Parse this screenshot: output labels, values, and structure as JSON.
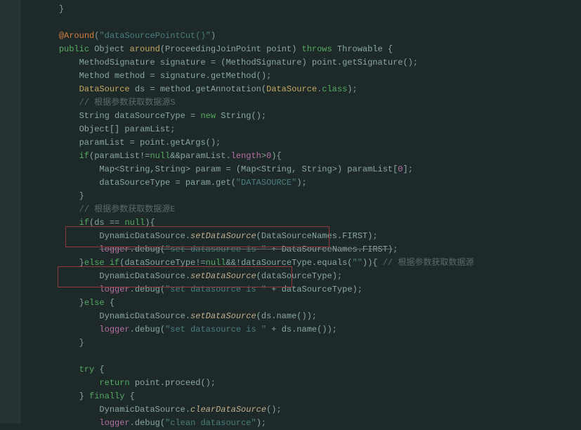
{
  "l1": "}",
  "l2": "@Around",
  "l2b": "(",
  "l2c": "\"dataSourcePointCut()\"",
  "l2d": ")",
  "l3a": "public",
  "l3b": " Object ",
  "l3c": "around",
  "l3d": "(ProceedingJoinPoint point) ",
  "l3e": "throws",
  "l3f": " Throwable {",
  "l4": "MethodSignature signature = (MethodSignature) point.getSignature()",
  "l4b": ";",
  "l5": "Method method = signature.getMethod()",
  "l5b": ";",
  "l6a": "DataSource",
  "l6b": " ds = method.getAnnotation(",
  "l6c": "DataSource",
  "l6d": ".",
  "l6e": "class",
  "l6f": ")",
  "l6g": ";",
  "l7": "// 根据参数获取数据源S",
  "l8a": "String dataSourceType = ",
  "l8b": "new",
  "l8c": " String()",
  "l8d": ";",
  "l9": "Object[] paramList",
  "l9b": ";",
  "l10": "paramList = point.getArgs()",
  "l10b": ";",
  "l11a": "if",
  "l11b": "(paramList!=",
  "l11c": "null",
  "l11d": "&&paramList.",
  "l11e": "length",
  "l11f": ">",
  "l11g": "0",
  "l11h": "){",
  "l12a": "Map<String,String> param = (Map<String, String>) paramList[",
  "l12b": "0",
  "l12c": "]",
  "l12d": ";",
  "l13a": "dataSourceType = param.get(",
  "l13b": "\"DATASOURCE\"",
  "l13c": ")",
  "l13d": ";",
  "l14": "}",
  "l15": "// 根据参数获取数据源E",
  "l16a": "if",
  "l16b": "(ds == ",
  "l16c": "null",
  "l16d": "){",
  "l17a": "DynamicDataSource.",
  "l17b": "setDataSource",
  "l17c": "(DataSourceNames.FIRST)",
  "l17d": ";",
  "l18a": "logger",
  "l18b": ".debug(",
  "l18c": "\"set datasource is \"",
  "l18d": " + DataSourceNames.FIRST)",
  "l18e": ";",
  "l19a": "}",
  "l19b": "else if",
  "l19c": "(dataSourceType!=",
  "l19d": "null",
  "l19e": "&&!dataSourceType.equals(",
  "l19f": "\"\"",
  "l19g": ")){ ",
  "l19h": "// 根据参数获取数据源",
  "l20a": "DynamicDataSource.",
  "l20b": "setDataSource",
  "l20c": "(dataSourceType)",
  "l20d": ";",
  "l21a": "logger",
  "l21b": ".debug(",
  "l21c": "\"set datasource is \"",
  "l21d": " + dataSourceType)",
  "l21e": ";",
  "l22a": "}",
  "l22b": "else",
  "l22c": " {",
  "l23a": "DynamicDataSource.",
  "l23b": "setDataSource",
  "l23c": "(ds.name())",
  "l23d": ";",
  "l24a": "logger",
  "l24b": ".debug(",
  "l24c": "\"set datasource is \"",
  "l24d": " + ds.name())",
  "l24e": ";",
  "l25": "}",
  "l26a": "try",
  "l26b": " {",
  "l27a": "return",
  "l27b": " point.proceed()",
  "l27c": ";",
  "l28a": "} ",
  "l28b": "finally",
  "l28c": " {",
  "l29a": "DynamicDataSource.",
  "l29b": "clearDataSource",
  "l29c": "()",
  "l29d": ";",
  "l30a": "logger",
  "l30b": ".debug(",
  "l30c": "\"clean datasource\"",
  "l30d": ")",
  "l30e": ";"
}
